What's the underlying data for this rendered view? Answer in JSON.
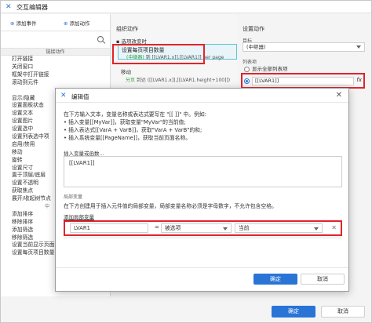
{
  "window": {
    "title": "交互编辑器"
  },
  "left": {
    "add_event": "添加事件",
    "add_action": "添加动作",
    "section_link": "链接动作",
    "items_a": [
      "打开链接",
      "关闭窗口",
      "框架中打开链接",
      "滚动到元件"
    ],
    "items_b": [
      "显示/隐藏",
      "设置面板状态",
      "设置文本",
      "设置图片",
      "设置选中",
      "设置列表选中项",
      "启用/禁用",
      "移动",
      "旋转",
      "设置尺寸",
      "置于顶层/底层",
      "设置不透明",
      "获取焦点",
      "展开/收起树节点"
    ],
    "mid_label": "中",
    "items_c": [
      "添加排序",
      "移除排序",
      "添加筛选",
      "移除筛选",
      "设置当前显示页面",
      "设置每页项目数量"
    ]
  },
  "mid": {
    "header": "组织动作",
    "case": "选项改变时",
    "selected_title": "设置每页项目数量",
    "selected_target": "(中继器)",
    "selected_detail": " 到 [[LVAR1.x]],[[LVAR1]] per page",
    "move_title": "移动",
    "move_target": "分页",
    "move_detail": " 到达 ([[LVAR1.x]],[[LVAR1.height+100]])"
  },
  "right": {
    "header": "设置动作",
    "target_label": "目标",
    "target_value": "(中继器)",
    "list_label": "列表项",
    "option1": "显示全部列表项",
    "option2_value": "[[LVAR1]]",
    "fx": "fx"
  },
  "modal": {
    "title": "编辑值",
    "close": "✕",
    "desc": [
      "在下方输入文本，变量名称或表达式要写在 \"[[ ]]\" 中。例如:",
      "• 插入变量[[MyVar]]，获取变量\"MyVar\"的当前值;",
      "• 插入表达式[[VarA + VarB]]，获取\"VarA + VarB\"的和;",
      "• 插入系统变量[[PageName]]，获取当前页面名称。"
    ],
    "insert_label": "插入变量或函数...",
    "text_value": "[[LVAR1]]",
    "local_var_heading": "局部变量",
    "local_var_desc": "在下方创建用于插入元件值的局部变量，局部变量名称必须是字母数字，不允许包含空格。",
    "add_local_var": "添加局部变量",
    "row": {
      "name": "LVAR1",
      "eq": "=",
      "type": "被选项",
      "target": "当前",
      "remove": "✕"
    },
    "ok": "确定",
    "cancel": "取消"
  },
  "footer": {
    "ok": "确定",
    "cancel": "取消"
  },
  "colors": {
    "accent": "#2a74d6",
    "highlight": "#e0242b",
    "green": "#2e9e3a"
  }
}
